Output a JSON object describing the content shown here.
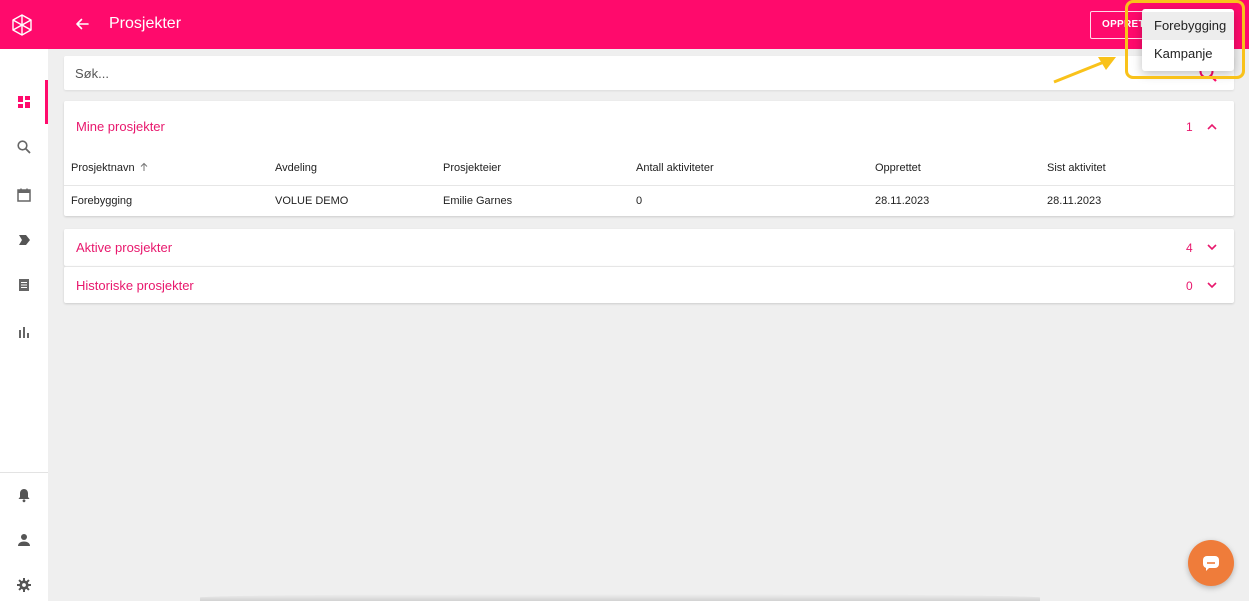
{
  "app": {
    "title": "Prosjekter",
    "create_button_label": "OPPRETT",
    "accent_color": "#ff0a6c"
  },
  "search": {
    "placeholder": "Søk...",
    "value": ""
  },
  "sidebar": {
    "items": [
      {
        "icon": "dashboard-icon",
        "active": true
      },
      {
        "icon": "search-icon",
        "active": false
      },
      {
        "icon": "calendar-icon",
        "active": false
      },
      {
        "icon": "label-icon",
        "active": false
      },
      {
        "icon": "document-icon",
        "active": false
      },
      {
        "icon": "bar-chart-icon",
        "active": false
      }
    ],
    "bottom_items": [
      {
        "icon": "bell-icon"
      },
      {
        "icon": "person-icon"
      },
      {
        "icon": "gear-icon"
      }
    ]
  },
  "sections": {
    "mine": {
      "title": "Mine prosjekter",
      "count": "1",
      "expanded": true,
      "columns": [
        "Prosjektnavn",
        "Avdeling",
        "Prosjekteier",
        "Antall aktiviteter",
        "Opprettet",
        "Sist aktivitet"
      ],
      "rows": [
        [
          "Forebygging",
          "VOLUE DEMO",
          "Emilie Garnes",
          "0",
          "28.11.2023",
          "28.11.2023"
        ]
      ]
    },
    "aktive": {
      "title": "Aktive prosjekter",
      "count": "4",
      "expanded": false
    },
    "historiske": {
      "title": "Historiske prosjekter",
      "count": "0",
      "expanded": false
    }
  },
  "dropdown": {
    "items": [
      "Forebygging",
      "Kampanje"
    ],
    "highlighted_index": 0
  },
  "annotation": {
    "color": "#f9c21a"
  },
  "chat": {
    "icon": "chat-icon",
    "color": "#ef7c3a"
  }
}
